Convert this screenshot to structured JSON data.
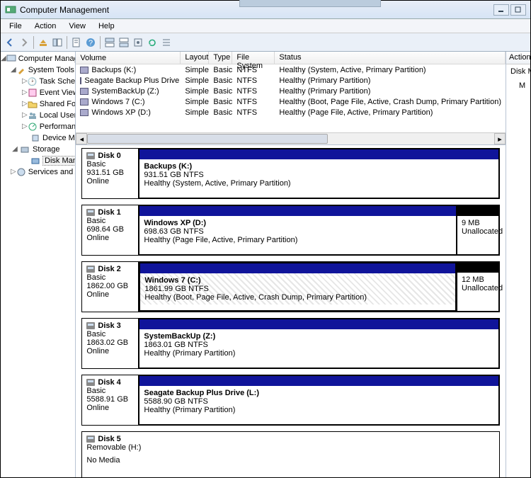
{
  "window": {
    "title": "Computer Management"
  },
  "menu": {
    "file": "File",
    "action": "Action",
    "view": "View",
    "help": "Help"
  },
  "tree": {
    "root": "Computer Management (Local)",
    "systools": "System Tools",
    "systools_items": [
      "Task Scheduler",
      "Event Viewer",
      "Shared Folders",
      "Local Users and Groups",
      "Performance",
      "Device Manager"
    ],
    "storage": "Storage",
    "diskmgmt": "Disk Management",
    "services": "Services and Applications"
  },
  "vol_head": {
    "volume": "Volume",
    "layout": "Layout",
    "type": "Type",
    "fs": "File System",
    "status": "Status"
  },
  "volumes": [
    {
      "name": "Backups (K:)",
      "layout": "Simple",
      "type": "Basic",
      "fs": "NTFS",
      "status": "Healthy (System, Active, Primary Partition)"
    },
    {
      "name": "Seagate Backup Plus Drive (L:)",
      "layout": "Simple",
      "type": "Basic",
      "fs": "NTFS",
      "status": "Healthy (Primary Partition)"
    },
    {
      "name": "SystemBackUp (Z:)",
      "layout": "Simple",
      "type": "Basic",
      "fs": "NTFS",
      "status": "Healthy (Primary Partition)"
    },
    {
      "name": "Windows 7 (C:)",
      "layout": "Simple",
      "type": "Basic",
      "fs": "NTFS",
      "status": "Healthy (Boot, Page File, Active, Crash Dump, Primary Partition)"
    },
    {
      "name": "Windows XP (D:)",
      "layout": "Simple",
      "type": "Basic",
      "fs": "NTFS",
      "status": "Healthy (Page File, Active, Primary Partition)"
    }
  ],
  "disks": {
    "d0": {
      "name": "Disk 0",
      "type": "Basic",
      "size": "931.51 GB",
      "state": "Online",
      "p0": {
        "name": "Backups  (K:)",
        "size": "931.51 GB NTFS",
        "status": "Healthy (System, Active, Primary Partition)"
      }
    },
    "d1": {
      "name": "Disk 1",
      "type": "Basic",
      "size": "698.64 GB",
      "state": "Online",
      "p0": {
        "name": "Windows XP  (D:)",
        "size": "698.63 GB NTFS",
        "status": "Healthy (Page File, Active, Primary Partition)"
      },
      "u": {
        "size": "9 MB",
        "status": "Unallocated"
      }
    },
    "d2": {
      "name": "Disk 2",
      "type": "Basic",
      "size": "1862.00 GB",
      "state": "Online",
      "p0": {
        "name": "Windows 7  (C:)",
        "size": "1861.99 GB NTFS",
        "status": "Healthy (Boot, Page File, Active, Crash Dump, Primary Partition)"
      },
      "u": {
        "size": "12 MB",
        "status": "Unallocated"
      }
    },
    "d3": {
      "name": "Disk 3",
      "type": "Basic",
      "size": "1863.02 GB",
      "state": "Online",
      "p0": {
        "name": "SystemBackUp  (Z:)",
        "size": "1863.01 GB NTFS",
        "status": "Healthy (Primary Partition)"
      }
    },
    "d4": {
      "name": "Disk 4",
      "type": "Basic",
      "size": "5588.91 GB",
      "state": "Online",
      "p0": {
        "name": "Seagate Backup Plus Drive  (L:)",
        "size": "5588.90 GB NTFS",
        "status": "Healthy (Primary Partition)"
      }
    },
    "d5": {
      "name": "Disk 5",
      "type": "Removable (H:)",
      "nomedia": "No Media"
    }
  },
  "actions": {
    "header": "Actions",
    "diskm": "Disk M",
    "more": "M"
  }
}
